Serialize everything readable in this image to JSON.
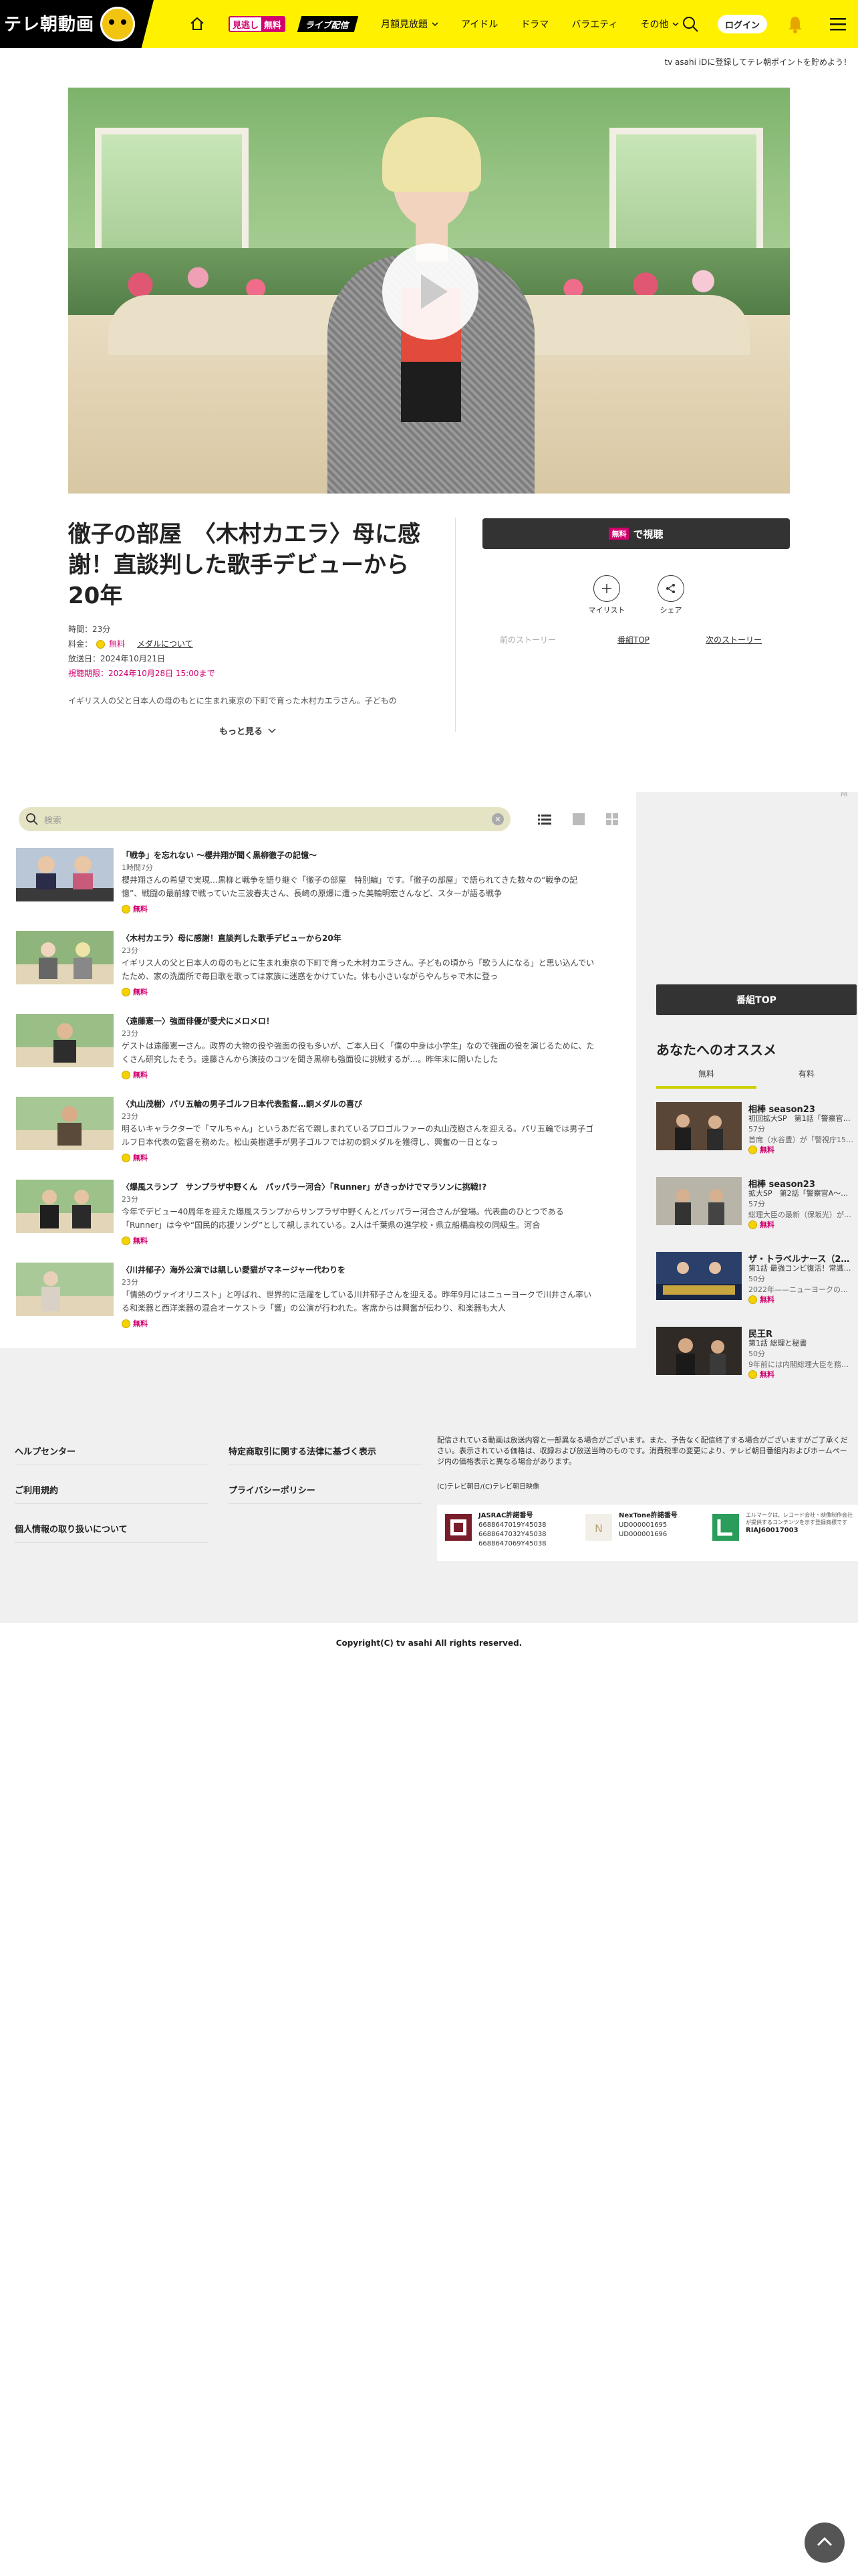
{
  "header": {
    "logo_text": "テレ朝動画",
    "free_badge_a": "見逃し",
    "free_badge_b": "無料",
    "live_badge": "ライブ配信",
    "nav": [
      "月額見放題",
      "アイドル",
      "ドラマ",
      "バラエティ",
      "その他"
    ],
    "login": "ログイン",
    "icons": [
      "home-icon",
      "search-icon",
      "bell-icon",
      "menu-icon"
    ],
    "accent_color": "#fff100"
  },
  "promo": "tv asahi iDに登録してテレ朝ポイントを貯めよう！",
  "program": {
    "title": "徹子の部屋　〈木村カエラ〉母に感謝！直談判した歌手デビューから20年",
    "time_label": "時間：",
    "time_value": "23分",
    "fee_label": "料金：",
    "fee_value": "無料",
    "media_link": "メダルについて",
    "air_label": "放送日：",
    "air_value": "2024年10月21日",
    "period_label": "視聴期限：",
    "period_value": "2024年10月28日 15:00まで",
    "description": "イギリス人の父と日本人の母のもとに生まれ東京の下町で育った木村カエラさん。子どもの",
    "more": "もっと見る"
  },
  "actions": {
    "watch_tag": "無料",
    "watch_label": "で視聴",
    "mylist": "マイリスト",
    "share": "シェア",
    "prev_story": "前のストーリー",
    "program_top": "番組TOP",
    "next_story": "次のストーリー"
  },
  "list": {
    "search_placeholder": "検索",
    "pr_label": "PR",
    "episodes": [
      {
        "title": "「戦争」を忘れない ～櫻井翔が聞く黒柳徹子の記憶～",
        "duration": "1時間7分",
        "desc": "櫻井翔さんの希望で実現…黒柳と戦争を語り継ぐ「徹子の部屋　特別編」です。「徹子の部屋」で語られてきた数々の“戦争の記憶”、戦闘の最前線で戦っていた三波春夫さん、長崎の原爆に遭った美輪明宏さんなど、スターが語る戦争",
        "free": "無料"
      },
      {
        "title": "〈木村カエラ〉母に感謝！直談判した歌手デビューから20年",
        "duration": "23分",
        "desc": "イギリス人の父と日本人の母のもとに生まれ東京の下町で育った木村カエラさん。子どもの頃から「歌う人になる」と思い込んでいたため、家の洗面所で毎日歌を歌っては家族に迷惑をかけていた。体も小さいながらやんちゃで木に登っ",
        "free": "無料"
      },
      {
        "title": "〈遠藤憲一〉強面俳優が愛犬にメロメロ！",
        "duration": "23分",
        "desc": "ゲストは遠藤憲一さん。政界の大物の役や強面の役も多いが、ご本人曰く「僕の中身は小学生」なので強面の役を演じるために、たくさん研究したそう。遠藤さんから演技のコツを聞き黒柳も強面役に挑戦するが…。昨年末に開いたした",
        "free": "無料"
      },
      {
        "title": "〈丸山茂樹〉パリ五輪の男子ゴルフ日本代表監督…銅メダルの喜び",
        "duration": "23分",
        "desc": "明るいキャラクターで「マルちゃん」というあだ名で親しまれているプロゴルファーの丸山茂樹さんを迎える。パリ五輪では男子ゴルフ日本代表の監督を務めた。松山英樹選手が男子ゴルフでは初の銅メダルを獲得し、興奮の一日となっ",
        "free": "無料"
      },
      {
        "title": "〈爆風スランプ　サンプラザ中野くん　パッパラー河合〉「Runner」がきっかけでマラソンに挑戦!?",
        "duration": "23分",
        "desc": "今年でデビュー40周年を迎えた爆風スランプからサンプラザ中野くんとパッパラー河合さんが登場。代表曲のひとつである「Runner」は今や“国民的応援ソング”として親しまれている。2人は千葉県の進学校・県立船橋高校の同級生。河合",
        "free": "無料"
      },
      {
        "title": "〈川井郁子〉海外公演では親しい愛猫がマネージャー代わりを",
        "duration": "23分",
        "desc": "「情熱のヴァイオリニスト」と呼ばれ、世界的に活躍をしている川井郁子さんを迎える。昨年9月にはニューヨークで川井さん率いる和楽器と西洋楽器の混合オーケストラ「響」の公演が行われた。客席からは興奮が伝わり、和楽器も大人",
        "free": "無料"
      }
    ]
  },
  "sidebar": {
    "program_top": "番組TOP",
    "rec_title": "あなたへのオススメ",
    "tab_free": "無料",
    "tab_paid": "有料",
    "items": [
      {
        "title": "相棒 season23",
        "sub": "初回拡大SP　第1話「警察官…",
        "dur": "57分",
        "desc": "首席（水谷豊）が「警視庁15…",
        "free": "無料"
      },
      {
        "title": "相棒 season23",
        "sub": "拡大SP　第2話「警察官A～…",
        "dur": "57分",
        "desc": "総理大臣の最新（保坂光）が…",
        "free": "無料"
      },
      {
        "title": "ザ・トラベルナース（2…",
        "sub": "第1話 最強コンビ復活！常識…",
        "dur": "50分",
        "desc": "2022年——ニューヨークの…",
        "free": "無料"
      },
      {
        "title": "民王R",
        "sub": "第1話 総理と秘書",
        "dur": "50分",
        "desc": "9年前には内閣総理大臣を務…",
        "free": "無料"
      }
    ]
  },
  "footer": {
    "links": [
      "ヘルプセンター",
      "ご利用規約",
      "個人情報の取り扱いについて",
      "特定商取引に関する法律に基づく表示",
      "プライバシーポリシー"
    ],
    "note": "配信されている動画は放送内容と一部異なる場合がございます。また、予告なく配信終了する場合がございますがご了承ください。表示されている価格は、収録および放送当時のものです。消費税率の変更により、テレビ朝日番組内およびホームページ内の価格表示と異なる場合があります。",
    "small": "(C)テレビ朝日/(C)テレビ朝日映像",
    "jasrac_title": "JASRAC許諾番号",
    "jasrac_nums": "6688647019Y45038\n6688647032Y45038\n6688647069Y45038",
    "nextone_title": "NexTone許諾番号",
    "nextone_nums": "UD000001695\nUD000001696",
    "lmark_text": "エルマークは、レコード会社・映像制作会社が提供するコンテンツを示す登録商標です",
    "lmark_num": "RIAJ60017003",
    "copyright": "Copyright(C) tv asahi All rights reserved."
  }
}
